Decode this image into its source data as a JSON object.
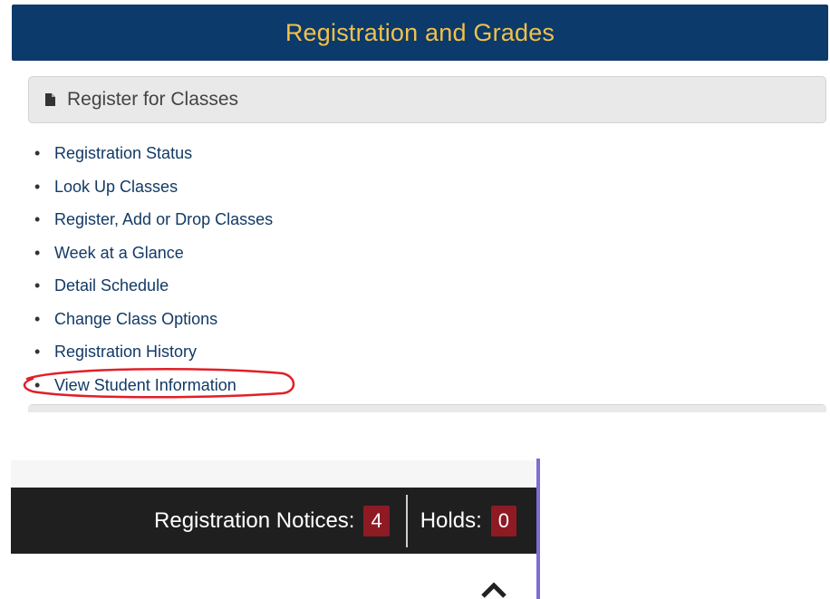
{
  "header": {
    "title": "Registration and Grades"
  },
  "section": {
    "title": "Register for Classes",
    "icon": "document-icon"
  },
  "links": [
    "Registration Status",
    "Look Up Classes",
    "Register, Add or Drop Classes",
    "Week at a Glance",
    "Detail Schedule",
    "Change Class Options",
    "Registration History",
    "View Student Information"
  ],
  "notices_bar": {
    "notices_label": "Registration Notices:",
    "notices_count": "4",
    "holds_label": "Holds:",
    "holds_count": "0"
  },
  "colors": {
    "header_bg": "#0b3a6b",
    "header_text": "#f2c14b",
    "link": "#123a66",
    "badge": "#8e1a24",
    "annotation": "#e0202a"
  }
}
